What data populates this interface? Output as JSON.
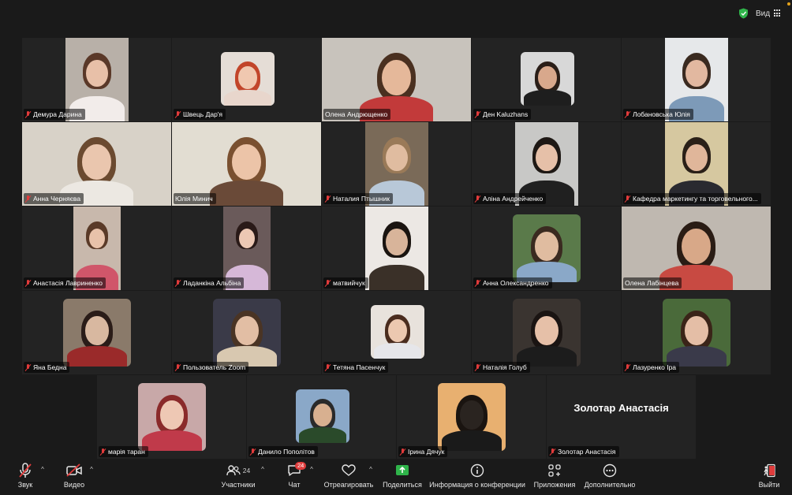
{
  "topbar": {
    "view_label": "Вид"
  },
  "participants": [
    {
      "name": "Демура Дарина",
      "muted": true,
      "active": false,
      "bg": "#b8b0a8",
      "shirt": "#f2ecea",
      "hair": "#5a3828",
      "skin": "#e8c0a8"
    },
    {
      "name": "Швець Дар'я",
      "muted": true,
      "active": false,
      "bg": "#e5ddd6",
      "shirt": "#e8d6cc",
      "hair": "#c2452a",
      "skin": "#f0c8b0"
    },
    {
      "name": "Олена Андрющенко",
      "muted": false,
      "active": true,
      "bg": "#c8c3bc",
      "shirt": "#c23a3a",
      "hair": "#4a3020",
      "skin": "#e5b89a"
    },
    {
      "name": "Ден Kaluzhans",
      "muted": true,
      "active": false,
      "bg": "#d8d8d8",
      "shirt": "#1e1e1e",
      "hair": "#2a1e18",
      "skin": "#d8a88c"
    },
    {
      "name": "Лобановська Юлія",
      "muted": true,
      "active": false,
      "bg": "#e6e8ea",
      "shirt": "#7d9ab8",
      "hair": "#3a2a20",
      "skin": "#e2b8a0"
    },
    {
      "name": "Анна Черняєва",
      "muted": true,
      "active": false,
      "bg": "#d8d2c8",
      "shirt": "#ece8e2",
      "hair": "#6b4a30",
      "skin": "#eac6ae"
    },
    {
      "name": "Юлія Минич",
      "muted": false,
      "active": false,
      "bg": "#e2ddd2",
      "shirt": "#6a4a38",
      "hair": "#7a5030",
      "skin": "#ecc4a8"
    },
    {
      "name": "Наталия Птышник",
      "muted": true,
      "active": false,
      "bg": "#7a6a58",
      "shirt": "#b8c8d8",
      "hair": "#9a7a58",
      "skin": "#e0bca0"
    },
    {
      "name": "Аліна Андрейченко",
      "muted": true,
      "active": false,
      "bg": "#c8c8c6",
      "shirt": "#202020",
      "hair": "#1e1814",
      "skin": "#e6c0a8"
    },
    {
      "name": "Кафедра маркетингу та торговельного...",
      "muted": true,
      "active": false,
      "bg": "#d6c8a0",
      "shirt": "#2a2a30",
      "hair": "#2a2018",
      "skin": "#e0b69a"
    },
    {
      "name": "Анастасія Лавриненко",
      "muted": true,
      "active": false,
      "bg": "#c8b8ac",
      "shirt": "#d0566a",
      "hair": "#5a3a28",
      "skin": "#e8c2aa"
    },
    {
      "name": "Ладанкіна Альбіна",
      "muted": true,
      "active": false,
      "bg": "#6a5a5a",
      "shirt": "#d6b8d8",
      "hair": "#2a1a18",
      "skin": "#ecc8b4"
    },
    {
      "name": "матвийчук",
      "muted": true,
      "active": false,
      "bg": "#ece8e4",
      "shirt": "#3a3028",
      "hair": "#1a1410",
      "skin": "#d8b49a"
    },
    {
      "name": "Анна Олександренко",
      "muted": true,
      "active": false,
      "bg": "#5a7a4a",
      "shirt": "#8aa8c8",
      "hair": "#3a2a20",
      "skin": "#e0bca0"
    },
    {
      "name": "Олена Лабінцева",
      "muted": false,
      "active": false,
      "bg": "#bfb8b0",
      "shirt": "#c84a42",
      "hair": "#2a1c14",
      "skin": "#d8a888"
    },
    {
      "name": "Яна Бедна",
      "muted": true,
      "active": false,
      "bg": "#8a7a6a",
      "shirt": "#9a2a2a",
      "hair": "#2a1c18",
      "skin": "#d8b8a0"
    },
    {
      "name": "Пользователь Zoom",
      "muted": true,
      "active": false,
      "bg": "#3a3a48",
      "shirt": "#d8c8b0",
      "hair": "#4a3424",
      "skin": "#e2bea4"
    },
    {
      "name": "Тетяна Пасенчук",
      "muted": true,
      "active": false,
      "bg": "#e8e2dc",
      "shirt": "#e6e6ea",
      "hair": "#4a2c1e",
      "skin": "#ecc8b0"
    },
    {
      "name": "Наталія Голуб",
      "muted": true,
      "active": false,
      "bg": "#3a3430",
      "shirt": "#1c1c1c",
      "hair": "#1a1412",
      "skin": "#e6c0a8"
    },
    {
      "name": "Лазуренко Іра",
      "muted": true,
      "active": false,
      "bg": "#4a6a3a",
      "shirt": "#3a3a4a",
      "hair": "#3a2418",
      "skin": "#e4bea6"
    },
    {
      "name": "марія таран",
      "muted": true,
      "active": false,
      "bg": "#c8a8a8",
      "shirt": "#c03a4a",
      "hair": "#8a2a2a",
      "skin": "#eec8b4"
    },
    {
      "name": "Данило Пополітов",
      "muted": true,
      "active": false,
      "bg": "#8aa8c8",
      "shirt": "#2a4a2a",
      "hair": "#2a2a2a",
      "skin": "#d8b090"
    },
    {
      "name": "Ірина Дячук",
      "muted": true,
      "active": false,
      "bg": "#e8b070",
      "shirt": "#1a1a1a",
      "hair": "#1a1410",
      "skin": "#2a2420"
    },
    {
      "name": "Золотар Анастасія",
      "muted": true,
      "active": false,
      "camera_off": true
    }
  ],
  "toolbar": {
    "audio": "Звук",
    "video": "Видео",
    "participants": "Участники",
    "participants_count": "24",
    "chat": "Чат",
    "chat_badge": "24",
    "react": "Отреагировать",
    "share": "Поделиться",
    "info": "Информация о конференции",
    "apps": "Приложения",
    "more": "Дополнительно",
    "leave": "Выйти"
  },
  "colors": {
    "accent_green": "#3ac94c",
    "mute_red": "#e23b3b",
    "leave_red": "#e03c3c"
  }
}
